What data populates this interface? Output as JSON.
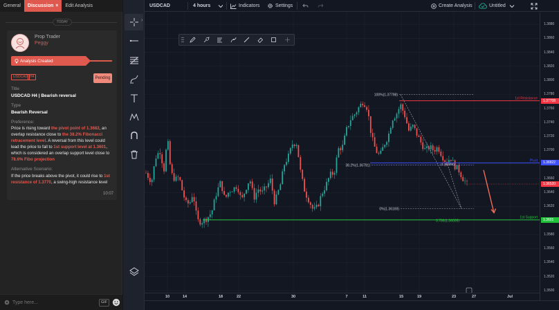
{
  "chat": {
    "tabs": [
      {
        "label": "General",
        "active": false
      },
      {
        "label": "Discussion",
        "active": true,
        "close": "×"
      },
      {
        "label": "Edit Analysis",
        "active": false
      }
    ],
    "day_separator": "TODAY",
    "message": {
      "sender_label": "Prop Trader",
      "sender_name": "Peggy",
      "analysis_badge": "Analysis Created",
      "tags": [
        "USDCAD",
        "H4"
      ],
      "status": "Pending",
      "title_label": "Title",
      "title_value": "USDCAD H4 | Bearish reversal",
      "type_label": "Type",
      "type_value": "Bearish Reversal",
      "preference_label": "Preference:",
      "preference_parts": [
        "Price is rising toward ",
        "the pivot point of 1.3682",
        ", an overlap resistance close to ",
        "the 38.2% Fibonacci retracement level",
        ". A reversal from this level could lead the price to fall to ",
        "1st support level at 1.3601",
        ", which is considered an overlap support level close to ",
        "78.6% Fibo projection"
      ],
      "alternative_label": "Alternative Scenario:",
      "alternative_parts": [
        "If the price breaks above the pivot, it could rise to ",
        "1st resistance of 1.3770",
        ", a swing-high resistance level"
      ],
      "time": "10:07"
    },
    "input": {
      "placeholder": "Type here...",
      "gif_label": "GIF"
    }
  },
  "toolbar": {
    "symbol": "USDCAD",
    "interval": "4 hours",
    "indicators_label": "Indicators",
    "settings_label": "Settings",
    "create_analysis_label": "Create Analysis",
    "layout_name": "Untitled"
  },
  "draw_tools": [
    "crosshair-icon",
    "trend-line-icon",
    "fib-tool-icon",
    "brush-icon",
    "text-icon",
    "pattern-icon",
    "magnet-icon",
    "trash-icon",
    "layers-icon"
  ],
  "float_tools": [
    "grip-icon",
    "pencil-icon",
    "brush-icon",
    "fill-icon",
    "style-icon",
    "line-width-icon",
    "eraser-icon",
    "box-icon",
    "more-icon"
  ],
  "chart_data": {
    "type": "candlestick",
    "symbol": "USDCAD",
    "timeframe": "4 hours",
    "ylim": [
      1.35,
      1.3885
    ],
    "price_ticks": [
      "1.3880",
      "1.3860",
      "1.3840",
      "1.3820",
      "1.3800",
      "1.3780",
      "1.3760",
      "1.3740",
      "1.3720",
      "1.3700",
      "1.3680",
      "1.3660",
      "1.3640",
      "1.3620",
      "1.3600",
      "1.3580",
      "1.3560",
      "1.3540",
      "1.3520",
      "1.3500"
    ],
    "time_ticks": [
      "10",
      "14",
      "18",
      "22",
      "30",
      "7",
      "11",
      "15",
      "19",
      "23",
      "27",
      "Jul"
    ],
    "levels": [
      {
        "name": "1st Resistance",
        "price": 1.37708,
        "label": "1.37708",
        "color": "#f23645"
      },
      {
        "name": "Pivot",
        "price": 1.36822,
        "label": "1.36822",
        "color": "#3f51ff"
      },
      {
        "name": "1st Support",
        "price": 1.3601,
        "label": "1.3601",
        "color": "#22c33a"
      }
    ],
    "current_price": {
      "label": "1.36520",
      "color": "#f23645"
    },
    "fibonacci": [
      {
        "label": "100%(1.37798)",
        "price": 1.37798
      },
      {
        "label": "38.2%(1.36791)",
        "price": 1.36791
      },
      {
        "label": "0%(1.36169)",
        "price": 1.36169
      },
      {
        "label": "0.786(1.36009)",
        "price": 1.36009
      },
      {
        "label": "(1.36809)",
        "price": 1.36809
      }
    ],
    "annotation": "bearish arrow toward 1st support"
  }
}
